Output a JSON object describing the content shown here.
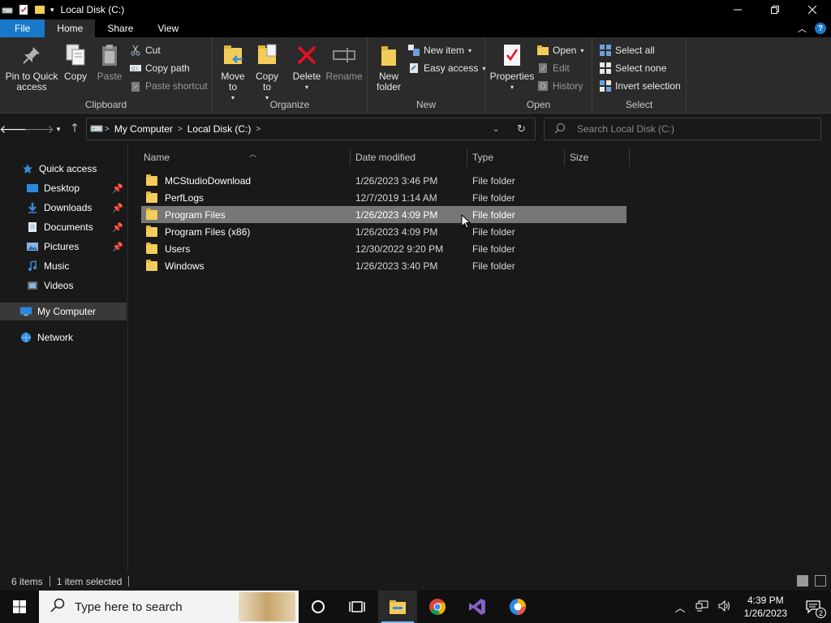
{
  "window": {
    "title": "Local Disk (C:)",
    "controls": [
      "minimize-icon",
      "restore-icon",
      "close-icon"
    ]
  },
  "ribbon_tabs": [
    "File",
    "Home",
    "Share",
    "View"
  ],
  "ribbon": {
    "clipboard": {
      "label": "Clipboard",
      "pin": "Pin to Quick access",
      "copy": "Copy",
      "paste": "Paste",
      "cut": "Cut",
      "copy_path": "Copy path",
      "paste_shortcut": "Paste shortcut"
    },
    "organize": {
      "label": "Organize",
      "move_to": "Move to",
      "copy_to": "Copy to",
      "delete": "Delete",
      "rename": "Rename"
    },
    "new": {
      "label": "New",
      "new_folder": "New folder",
      "new_item": "New item",
      "easy_access": "Easy access"
    },
    "open": {
      "label": "Open",
      "properties": "Properties",
      "open": "Open",
      "edit": "Edit",
      "history": "History"
    },
    "select": {
      "label": "Select",
      "select_all": "Select all",
      "select_none": "Select none",
      "invert_selection": "Invert selection"
    }
  },
  "address": {
    "crumbs": [
      "My Computer",
      "Local Disk (C:)"
    ],
    "search_placeholder": "Search Local Disk (C:)"
  },
  "nav": {
    "quick_access": "Quick access",
    "desktop": "Desktop",
    "downloads": "Downloads",
    "documents": "Documents",
    "pictures": "Pictures",
    "music": "Music",
    "videos": "Videos",
    "my_computer": "My Computer",
    "network": "Network"
  },
  "columns": {
    "name": "Name",
    "date": "Date modified",
    "type": "Type",
    "size": "Size"
  },
  "files": [
    {
      "name": "MCStudioDownload",
      "date": "1/26/2023 3:46 PM",
      "type": "File folder"
    },
    {
      "name": "PerfLogs",
      "date": "12/7/2019 1:14 AM",
      "type": "File folder"
    },
    {
      "name": "Program Files",
      "date": "1/26/2023 4:09 PM",
      "type": "File folder"
    },
    {
      "name": "Program Files (x86)",
      "date": "1/26/2023 4:09 PM",
      "type": "File folder"
    },
    {
      "name": "Users",
      "date": "12/30/2022 9:20 PM",
      "type": "File folder"
    },
    {
      "name": "Windows",
      "date": "1/26/2023 3:40 PM",
      "type": "File folder"
    }
  ],
  "status": {
    "count": "6 items",
    "selected": "1 item selected"
  },
  "taskbar": {
    "search_placeholder": "Type here to search",
    "time": "4:39 PM",
    "date": "1/26/2023",
    "notifications": "2"
  },
  "colors": {
    "accent": "#1979ca",
    "selected_row": "#777777",
    "folder": "#f4cc5a"
  }
}
